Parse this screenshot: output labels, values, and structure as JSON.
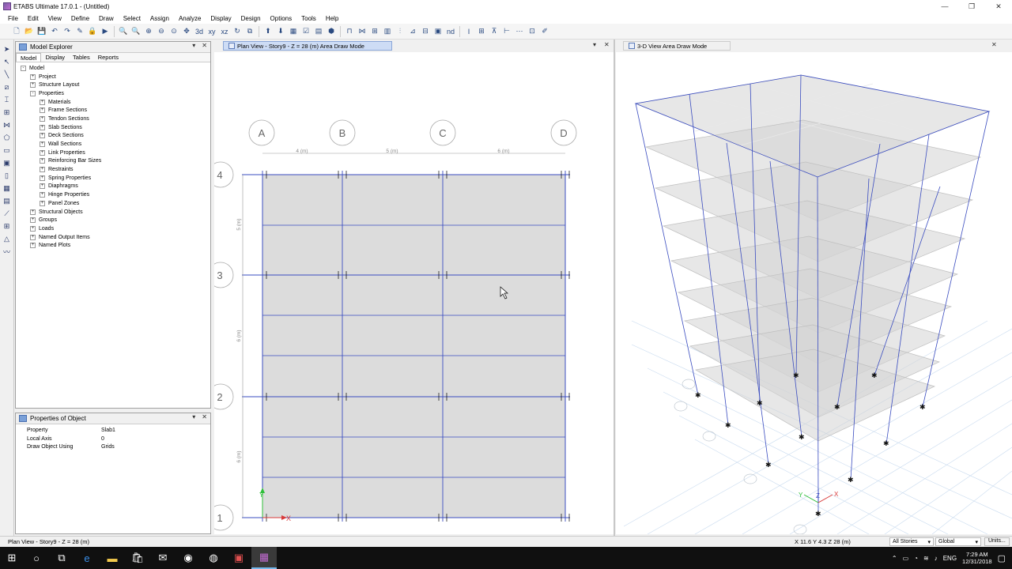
{
  "window": {
    "title": "ETABS Ultimate 17.0.1 - (Untitled)"
  },
  "menu": [
    "File",
    "Edit",
    "View",
    "Define",
    "Draw",
    "Select",
    "Assign",
    "Analyze",
    "Display",
    "Design",
    "Options",
    "Tools",
    "Help"
  ],
  "model_explorer": {
    "title": "Model Explorer",
    "tabs": [
      "Model",
      "Display",
      "Tables",
      "Reports"
    ],
    "tree": [
      {
        "label": "Model",
        "level": 0,
        "exp": "-"
      },
      {
        "label": "Project",
        "level": 1,
        "exp": "+"
      },
      {
        "label": "Structure Layout",
        "level": 1,
        "exp": "+"
      },
      {
        "label": "Properties",
        "level": 1,
        "exp": "-"
      },
      {
        "label": "Materials",
        "level": 2,
        "exp": "+"
      },
      {
        "label": "Frame Sections",
        "level": 2,
        "exp": "+"
      },
      {
        "label": "Tendon Sections",
        "level": 2,
        "exp": "+"
      },
      {
        "label": "Slab Sections",
        "level": 2,
        "exp": "+"
      },
      {
        "label": "Deck Sections",
        "level": 2,
        "exp": "+"
      },
      {
        "label": "Wall Sections",
        "level": 2,
        "exp": "+"
      },
      {
        "label": "Link Properties",
        "level": 2,
        "exp": "+"
      },
      {
        "label": "Reinforcing Bar Sizes",
        "level": 2,
        "exp": "+"
      },
      {
        "label": "Restraints",
        "level": 2,
        "exp": "+"
      },
      {
        "label": "Spring Properties",
        "level": 2,
        "exp": "+"
      },
      {
        "label": "Diaphragms",
        "level": 2,
        "exp": "+"
      },
      {
        "label": "Hinge Properties",
        "level": 2,
        "exp": "+"
      },
      {
        "label": "Panel Zones",
        "level": 2,
        "exp": "+"
      },
      {
        "label": "Structural Objects",
        "level": 1,
        "exp": "+"
      },
      {
        "label": "Groups",
        "level": 1,
        "exp": "+"
      },
      {
        "label": "Loads",
        "level": 1,
        "exp": "+"
      },
      {
        "label": "Named Output Items",
        "level": 1,
        "exp": "+"
      },
      {
        "label": "Named Plots",
        "level": 1,
        "exp": "+"
      }
    ]
  },
  "properties_panel": {
    "title": "Properties of Object",
    "rows": [
      {
        "key": "Property",
        "value": "Slab1"
      },
      {
        "key": "Local Axis",
        "value": "0"
      },
      {
        "key": "Draw Object Using",
        "value": "Grids"
      }
    ]
  },
  "plan_view": {
    "tab": "Plan View - Story9 - Z = 28 (m)  Area Draw Mode",
    "grid_x": [
      "A",
      "B",
      "C",
      "D"
    ],
    "grid_y": [
      "4",
      "3",
      "2",
      "1"
    ],
    "dims_x": [
      "4 (m)",
      "5 (m)",
      "6 (m)"
    ],
    "dims_y": [
      "5 (m)",
      "6 (m)",
      "6 (m)"
    ],
    "axis_x": "X",
    "axis_y": "Y"
  },
  "view_3d": {
    "tab": "3-D View  Area Draw Mode",
    "axis_labels": [
      "Y",
      "Z",
      "X"
    ]
  },
  "status": {
    "left": "Plan View - Story9 - Z = 28 (m)",
    "coords": "X 11.6  Y 4.3  Z 28 (m)",
    "stories": "All Stories",
    "coord_system": "Global",
    "units_button": "Units..."
  },
  "taskbar": {
    "language": "ENG",
    "time": "7:29 AM",
    "date": "12/31/2018"
  },
  "colors": {
    "grid_line": "#3a4cc0",
    "slab_fill": "#dcdcdc",
    "active_tab": "#cddcf5",
    "taskbar": "#101010"
  }
}
